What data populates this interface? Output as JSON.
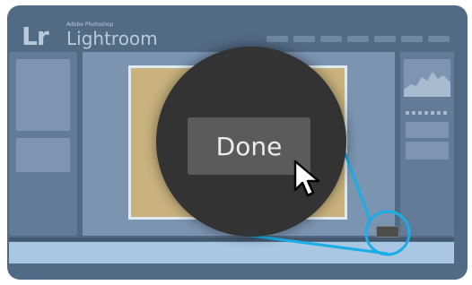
{
  "app": {
    "logo_text": "Lr",
    "logo_subtitle": "Adobe Photoshop",
    "name": "Lightroom"
  },
  "header": {
    "module_count": 7
  },
  "dialog": {
    "done_button_label": "Done"
  },
  "colors": {
    "background": "#526b85",
    "photo": "#c9b27e",
    "callout": "#19aee6",
    "magnifier": "#333333",
    "button": "#5b5b5b"
  },
  "icons": {
    "cursor": "arrow-pointer-icon",
    "magnifier": "magnifier-callout"
  }
}
